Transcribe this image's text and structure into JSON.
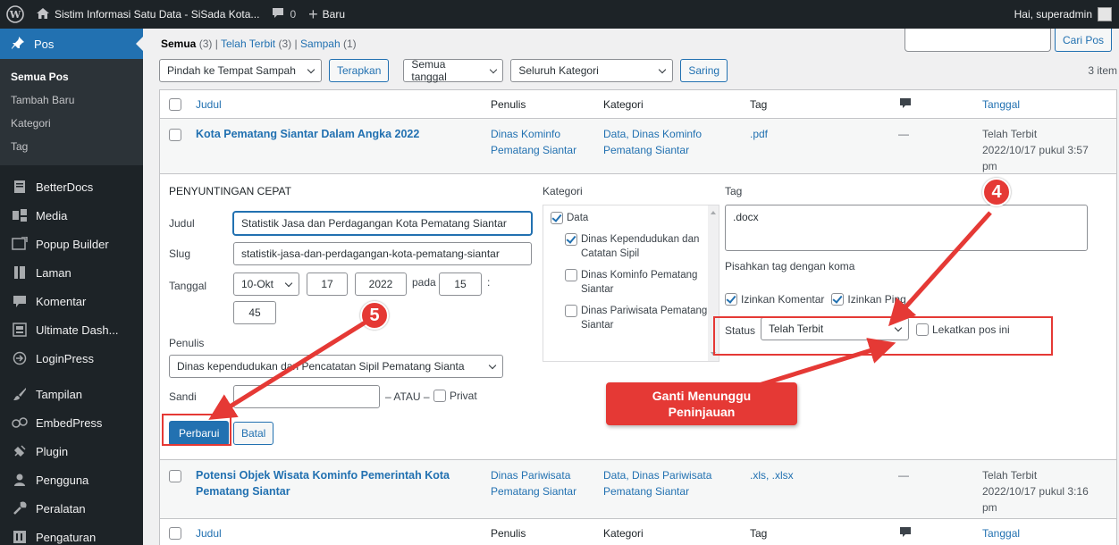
{
  "adminbar": {
    "site_title": "Sistim Informasi Satu Data - SiSada Kota...",
    "comments_count": "0",
    "new_label": "Baru",
    "greeting": "Hai, superadmin"
  },
  "sidebar": {
    "current": "Pos",
    "submenu": [
      "Semua Pos",
      "Tambah Baru",
      "Kategori",
      "Tag"
    ],
    "items": [
      {
        "label": "BetterDocs",
        "icon": "document-icon"
      },
      {
        "label": "Media",
        "icon": "media-icon"
      },
      {
        "label": "Popup Builder",
        "icon": "popup-icon"
      },
      {
        "label": "Laman",
        "icon": "page-icon"
      },
      {
        "label": "Komentar",
        "icon": "comment-icon"
      },
      {
        "label": "Ultimate Dash...",
        "icon": "dashboard-icon"
      },
      {
        "label": "LoginPress",
        "icon": "login-icon"
      },
      {
        "label": "Tampilan",
        "icon": "brush-icon"
      },
      {
        "label": "EmbedPress",
        "icon": "embed-icon"
      },
      {
        "label": "Plugin",
        "icon": "plugin-icon"
      },
      {
        "label": "Pengguna",
        "icon": "users-icon"
      },
      {
        "label": "Peralatan",
        "icon": "tools-icon"
      },
      {
        "label": "Pengaturan",
        "icon": "settings-icon"
      }
    ]
  },
  "views": {
    "all": "Semua",
    "all_count": "(3)",
    "published": "Telah Terbit",
    "published_count": "(3)",
    "trash": "Sampah",
    "trash_count": "(1)",
    "sep": "|"
  },
  "search": {
    "button": "Cari Pos",
    "value": ""
  },
  "tablenav": {
    "bulk_action": "Pindah ke Tempat Sampah",
    "apply": "Terapkan",
    "date_filter": "Semua tanggal",
    "category_filter": "Seluruh Kategori",
    "filter": "Saring",
    "items": "3 item"
  },
  "columns": {
    "title": "Judul",
    "author": "Penulis",
    "categories": "Kategori",
    "tags": "Tag",
    "date": "Tanggal"
  },
  "rows": [
    {
      "title": "Kota Pematang Siantar Dalam Angka 2022",
      "author": "Dinas Kominfo Pematang Siantar",
      "categories": "Data, Dinas Kominfo Pematang Siantar",
      "tags": ".pdf",
      "comments": "—",
      "status": "Telah Terbit",
      "date": "2022/10/17 pukul 3:57 pm"
    },
    {
      "title": "Potensi Objek Wisata Kominfo Pemerintah Kota Pematang Siantar",
      "author": "Dinas Pariwisata Pematang Siantar",
      "categories": "Data, Dinas Pariwisata Pematang Siantar",
      "tags": ".xls, .xlsx",
      "comments": "—",
      "status": "Telah Terbit",
      "date": "2022/10/17 pukul 3:16 pm"
    }
  ],
  "quick_edit": {
    "heading": "PENYUNTINGAN CEPAT",
    "title_label": "Judul",
    "title_value": "Statistik Jasa dan Perdagangan Kota Pematang Siantar",
    "slug_label": "Slug",
    "slug_value": "statistik-jasa-dan-perdagangan-kota-pematang-siantar",
    "date_label": "Tanggal",
    "month": "10-Okt",
    "day": "17",
    "year": "2022",
    "at": "pada",
    "hour": "15",
    "colon": ":",
    "minute": "45",
    "author_label": "Penulis",
    "author_value": "Dinas kependudukan dan Pencatatan Sipil Pematang Sianta",
    "password_label": "Sandi",
    "or": "– ATAU –",
    "private": "Privat",
    "categories_label": "Kategori",
    "categories": [
      {
        "label": "Data",
        "checked": true
      },
      {
        "label": "Dinas Kependudukan dan Catatan Sipil",
        "checked": true
      },
      {
        "label": "Dinas Kominfo Pematang Siantar",
        "checked": false
      },
      {
        "label": "Dinas Pariwisata Pematang Siantar",
        "checked": false
      }
    ],
    "tags_label": "Tag",
    "tags_value": ".docx",
    "tags_help": "Pisahkan tag dengan koma",
    "allow_comments": "Izinkan Komentar",
    "allow_pings": "Izinkan Ping",
    "status_label": "Status",
    "status_value": "Telah Terbit",
    "sticky": "Lekatkan pos ini",
    "update": "Perbarui",
    "cancel": "Batal"
  },
  "annotations": {
    "step4": "4",
    "step5": "5",
    "callout_line1": "Ganti Menunggu",
    "callout_line2": "Peninjauan"
  },
  "colors": {
    "accent": "#2271b1",
    "annotation": "#e53935",
    "admin_dark": "#1d2327"
  }
}
